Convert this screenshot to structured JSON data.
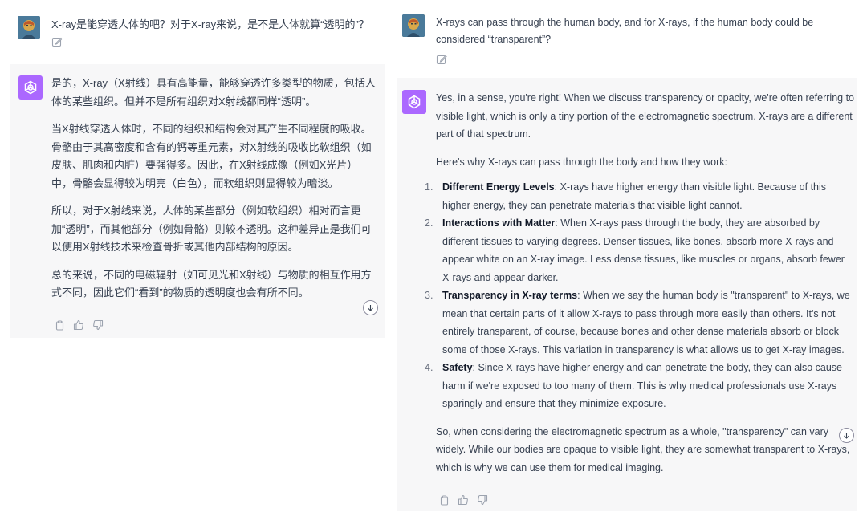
{
  "left": {
    "user_message": "X-ray是能穿透人体的吧？对于X-ray来说，是不是人体就算“透明的”？",
    "assistant_paragraphs": [
      "是的，X-ray（X射线）具有高能量，能够穿透许多类型的物质，包括人体的某些组织。但并不是所有组织对X射线都同样“透明”。",
      "当X射线穿透人体时，不同的组织和结构会对其产生不同程度的吸收。骨骼由于其高密度和含有的钙等重元素，对X射线的吸收比软组织（如皮肤、肌肉和内脏）要强得多。因此，在X射线成像（例如X光片）中，骨骼会显得较为明亮（白色），而软组织则显得较为暗淡。",
      "所以，对于X射线来说，人体的某些部分（例如软组织）相对而言更加“透明”，而其他部分（例如骨骼）则较不透明。这种差异正是我们可以使用X射线技术来检查骨折或其他内部结构的原因。",
      "总的来说，不同的电磁辐射（如可见光和X射线）与物质的相互作用方式不同，因此它们“看到”的物质的透明度也会有所不同。"
    ]
  },
  "right": {
    "user_message": "X-rays can pass through the human body, and for X-rays, if the human body could be considered “transparent”?",
    "intro": "Yes, in a sense, you're right! When we discuss transparency or opacity, we're often referring to visible light, which is only a tiny portion of the electromagnetic spectrum. X-rays are a different part of that spectrum.",
    "lead": "Here's why X-rays can pass through the body and how they work:",
    "reasons": [
      {
        "num": "1.",
        "title": "Different Energy Levels",
        "text": ": X-rays have higher energy than visible light. Because of this higher energy, they can penetrate materials that visible light cannot."
      },
      {
        "num": "2.",
        "title": "Interactions with Matter",
        "text": ": When X-rays pass through the body, they are absorbed by different tissues to varying degrees. Denser tissues, like bones, absorb more X-rays and appear white on an X-ray image. Less dense tissues, like muscles or organs, absorb fewer X-rays and appear darker."
      },
      {
        "num": "3.",
        "title": "Transparency in X-ray terms",
        "text": ": When we say the human body is \"transparent\" to X-rays, we mean that certain parts of it allow X-rays to pass through more easily than others. It's not entirely transparent, of course, because bones and other dense materials absorb or block some of those X-rays. This variation in transparency is what allows us to get X-ray images."
      },
      {
        "num": "4.",
        "title": "Safety",
        "text": ": Since X-rays have higher energy and can penetrate the body, they can also cause harm if we're exposed to too many of them. This is why medical professionals use X-rays sparingly and ensure that they minimize exposure."
      }
    ],
    "conclusion": "So, when considering the electromagnetic spectrum as a whole, \"transparency\" can vary widely. While our bodies are opaque to visible light, they are somewhat transparent to X-rays, which is why we can use them for medical imaging."
  },
  "icons": {
    "user_avatar": "user-avatar-portrait",
    "assistant_logo": "chatgpt-logo-icon",
    "edit": "edit-icon",
    "copy": "copy-icon",
    "thumbs_up": "thumbs-up-icon",
    "thumbs_down": "thumbs-down-icon",
    "scroll_down": "arrow-down-icon"
  },
  "colors": {
    "assistant_bg": "#f7f7f8",
    "logo_bg": "#ab68ff",
    "text": "#374151"
  }
}
